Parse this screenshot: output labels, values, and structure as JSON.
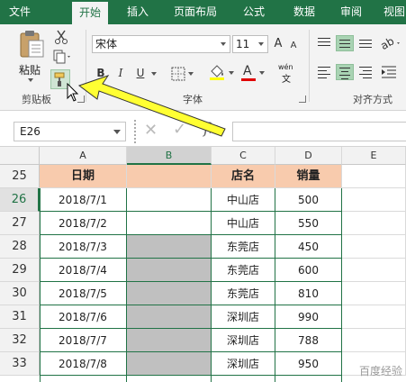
{
  "tabs": [
    {
      "label": "文件",
      "active": false
    },
    {
      "label": "开始",
      "active": true
    },
    {
      "label": "插入",
      "active": false
    },
    {
      "label": "页面布局",
      "active": false
    },
    {
      "label": "公式",
      "active": false
    },
    {
      "label": "数据",
      "active": false
    },
    {
      "label": "审阅",
      "active": false
    },
    {
      "label": "视图",
      "active": false
    }
  ],
  "ribbon": {
    "clipboard": {
      "paste_label": "粘贴",
      "group_label": "剪贴板"
    },
    "font": {
      "font_name": "宋体",
      "font_size": "11",
      "group_label": "字体",
      "bold": "B",
      "italic": "I",
      "underline": "U",
      "grow": "A",
      "shrink": "A",
      "phonetic": "wén"
    },
    "alignment": {
      "group_label": "对齐方式"
    }
  },
  "formula_bar": {
    "name_box": "E26",
    "cancel": "✕",
    "enter": "✓",
    "fx": "fx",
    "value": ""
  },
  "sheet": {
    "columns": [
      "A",
      "B",
      "C",
      "D",
      "E"
    ],
    "selected_column": "B",
    "header_row": {
      "row": "25",
      "cells": [
        "日期",
        "",
        "店名",
        "销量",
        ""
      ]
    },
    "rows": [
      {
        "row": "26",
        "cells": [
          "2018/7/1",
          "",
          "中山店",
          "500",
          ""
        ],
        "b_gray": false
      },
      {
        "row": "27",
        "cells": [
          "2018/7/2",
          "",
          "中山店",
          "550",
          ""
        ],
        "b_gray": false
      },
      {
        "row": "28",
        "cells": [
          "2018/7/3",
          "",
          "东莞店",
          "450",
          ""
        ],
        "b_gray": true
      },
      {
        "row": "29",
        "cells": [
          "2018/7/4",
          "",
          "东莞店",
          "600",
          ""
        ],
        "b_gray": true
      },
      {
        "row": "30",
        "cells": [
          "2018/7/5",
          "",
          "东莞店",
          "810",
          ""
        ],
        "b_gray": true
      },
      {
        "row": "31",
        "cells": [
          "2018/7/6",
          "",
          "深圳店",
          "990",
          ""
        ],
        "b_gray": true
      },
      {
        "row": "32",
        "cells": [
          "2018/7/7",
          "",
          "深圳店",
          "788",
          ""
        ],
        "b_gray": true
      },
      {
        "row": "33",
        "cells": [
          "2018/7/8",
          "",
          "深圳店",
          "950",
          ""
        ],
        "b_gray": true
      }
    ]
  },
  "watermark": "百度经验",
  "colors": {
    "excel_green": "#217346",
    "header_fill": "#f8cbad",
    "gray_fill": "#c0c0c0",
    "arrow_yellow": "#ffff33"
  }
}
